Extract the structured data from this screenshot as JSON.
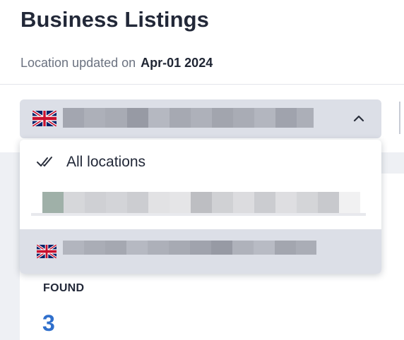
{
  "header": {
    "title": "Business Listings",
    "updated_label": "Location updated on",
    "updated_date": "Apr-01 2024"
  },
  "location_select": {
    "selected_flag": "uk-flag-icon",
    "chevron": "chevron-up-icon",
    "expanded": true
  },
  "dropdown": {
    "all_option": {
      "icon": "double-check-icon",
      "label": "All locations"
    },
    "options": [
      {
        "type": "blurred",
        "flag": null
      },
      {
        "type": "blurred",
        "flag": "uk-flag-icon",
        "selected": true
      }
    ]
  },
  "summary": {
    "found_label": "FOUND",
    "found_count": "3"
  },
  "colors": {
    "accent": "#2f6fcc",
    "select_bg": "#dcdfe7",
    "text_dark": "#222838",
    "text_muted": "#6b7280"
  }
}
